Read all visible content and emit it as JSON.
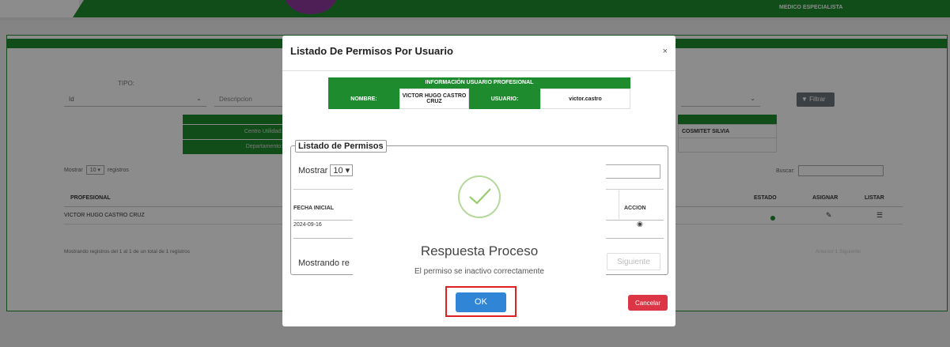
{
  "header": {
    "role": "MEDICO ESPECIALISTA"
  },
  "background": {
    "tipo_label": "TIPO:",
    "tipo_value": "Id",
    "descripcion_placeholder": "Descripcion",
    "filtrar_label": "Filtrar",
    "centro_utilidad_label": "Centro Utilidad:",
    "departamento_label": "Departamento:",
    "cosmitet_value": "COSMITET SILVIA",
    "mostrar_prefix": "Mostrar",
    "mostrar_value": "10",
    "mostrar_suffix": "registros",
    "buscar_label": "Buscar:",
    "columns": {
      "profesional": "PROFESIONAL",
      "estado": "ESTADO",
      "asignar": "ASIGNAR",
      "listar": "LISTAR"
    },
    "row_profesional": "VICTOR HUGO CASTRO CRUZ",
    "footer_info": "Mostrando registros del 1 al 1 de un total de 1 registros",
    "pagination": "Anterior  1  Siguiente"
  },
  "modal": {
    "title": "Listado De Permisos Por Usuario",
    "close": "×",
    "info_header": "INFORMACIÓN USUARIO PROFESIONAL",
    "nombre_label": "NOMBRE:",
    "nombre_value": "VICTOR HUGO CASTRO CRUZ",
    "usuario_label": "USUARIO:",
    "usuario_value": "victor.castro",
    "permisos_legend": "Listado de Permisos",
    "mostrar_prefix": "Mostrar",
    "mostrar_value": "10",
    "col_fecha_inicial": "FECHA INICIAL",
    "col_accion": "ACCION",
    "row_fecha": "2024-09-16",
    "footer_text": "Mostrando re",
    "next_label": "Siguiente",
    "cancelar_label": "Cancelar"
  },
  "alert": {
    "title": "Respuesta Proceso",
    "message": "El permiso se inactivo correctamente",
    "ok_label": "OK"
  },
  "colors": {
    "brand_green": "#1e8c2e",
    "ok_blue": "#3085d6",
    "cancel_red": "#dc3545",
    "highlight_red": "#e02020"
  }
}
